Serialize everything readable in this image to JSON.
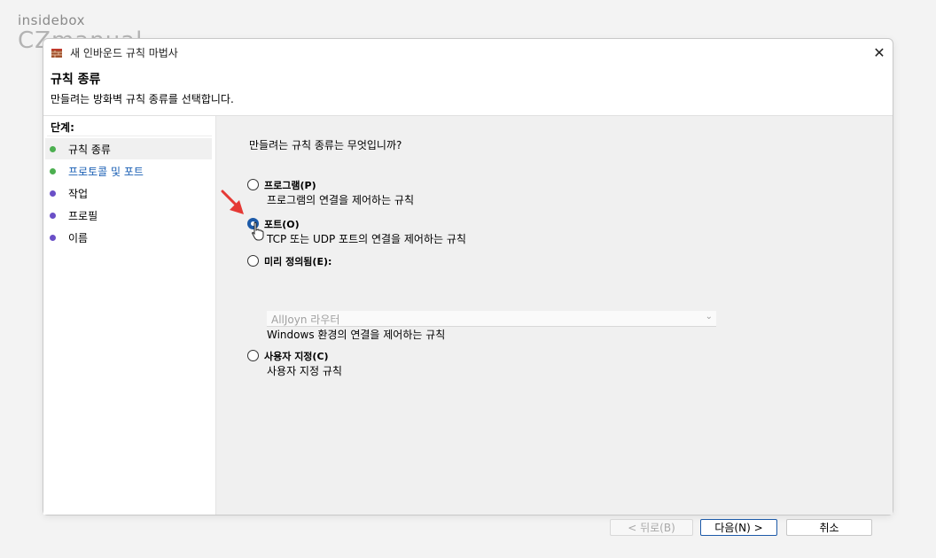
{
  "watermark": {
    "top": "insidebox",
    "bottom": "CZmanual"
  },
  "window": {
    "title": "새 인바운드 규칙 마법사",
    "close": "✕",
    "app_icon": "firewall-icon"
  },
  "header": {
    "title": "규칙 종류",
    "subtitle": "만들려는 방화벽 규칙 종류를 선택합니다."
  },
  "steps": {
    "heading": "단계:",
    "items": [
      {
        "label": "규칙 종류",
        "color": "#4caf50",
        "active": true
      },
      {
        "label": "프로토콜 및 포트",
        "color": "#4caf50",
        "link": true
      },
      {
        "label": "작업",
        "color": "#6a4fc7"
      },
      {
        "label": "프로필",
        "color": "#6a4fc7"
      },
      {
        "label": "이름",
        "color": "#6a4fc7"
      }
    ]
  },
  "content": {
    "question": "만들려는 규칙 종류는 무엇입니까?",
    "options": [
      {
        "label": "프로그램(P)",
        "desc": "프로그램의 연결을 제어하는 규칙",
        "checked": false
      },
      {
        "label": "포트(O)",
        "desc": "TCP 또는 UDP 포트의 연결을 제어하는 규칙",
        "checked": true
      },
      {
        "label": "미리 정의됨(E):",
        "desc": "Windows 환경의 연결을 제어하는 규칙",
        "checked": false
      },
      {
        "label": "사용자 지정(C)",
        "desc": "사용자 지정 규칙",
        "checked": false
      }
    ],
    "predefined_dropdown": {
      "value": "AllJoyn 라우터",
      "enabled": false
    }
  },
  "buttons": {
    "back": "< 뒤로(B)",
    "next": "다음(N) >",
    "cancel": "취소"
  },
  "colors": {
    "accent": "#1d5aa8",
    "annotation_arrow": "#e53935"
  }
}
